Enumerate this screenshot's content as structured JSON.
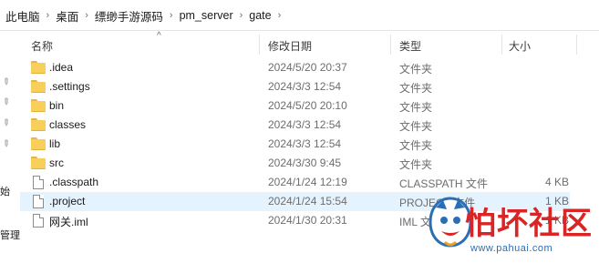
{
  "breadcrumb": [
    "此电脑",
    "桌面",
    "缥缈手游源码",
    "pm_server",
    "gate"
  ],
  "nav_fragments": [
    "始",
    "管理"
  ],
  "columns": {
    "name": "名称",
    "date": "修改日期",
    "type": "类型",
    "size": "大小"
  },
  "files": [
    {
      "name": ".idea",
      "date": "2024/5/20 20:37",
      "type": "文件夹",
      "size": "",
      "icon": "folder-icon"
    },
    {
      "name": ".settings",
      "date": "2024/3/3 12:54",
      "type": "文件夹",
      "size": "",
      "icon": "folder-icon"
    },
    {
      "name": "bin",
      "date": "2024/5/20 20:10",
      "type": "文件夹",
      "size": "",
      "icon": "folder-icon"
    },
    {
      "name": "classes",
      "date": "2024/3/3 12:54",
      "type": "文件夹",
      "size": "",
      "icon": "folder-icon"
    },
    {
      "name": "lib",
      "date": "2024/3/3 12:54",
      "type": "文件夹",
      "size": "",
      "icon": "folder-icon"
    },
    {
      "name": "src",
      "date": "2024/3/30 9:45",
      "type": "文件夹",
      "size": "",
      "icon": "folder-icon"
    },
    {
      "name": ".classpath",
      "date": "2024/1/24 12:19",
      "type": "CLASSPATH 文件",
      "size": "4 KB",
      "icon": "file-icon"
    },
    {
      "name": ".project",
      "date": "2024/1/24 15:54",
      "type": "PROJECT 文件",
      "size": "1 KB",
      "icon": "file-icon",
      "selected": true
    },
    {
      "name": "网关.iml",
      "date": "2024/1/30 20:31",
      "type": "IML 文件",
      "size": "1 KB",
      "icon": "file-icon"
    }
  ],
  "watermark": {
    "title": "怕坏社区",
    "url": "www.pahuai.com"
  }
}
